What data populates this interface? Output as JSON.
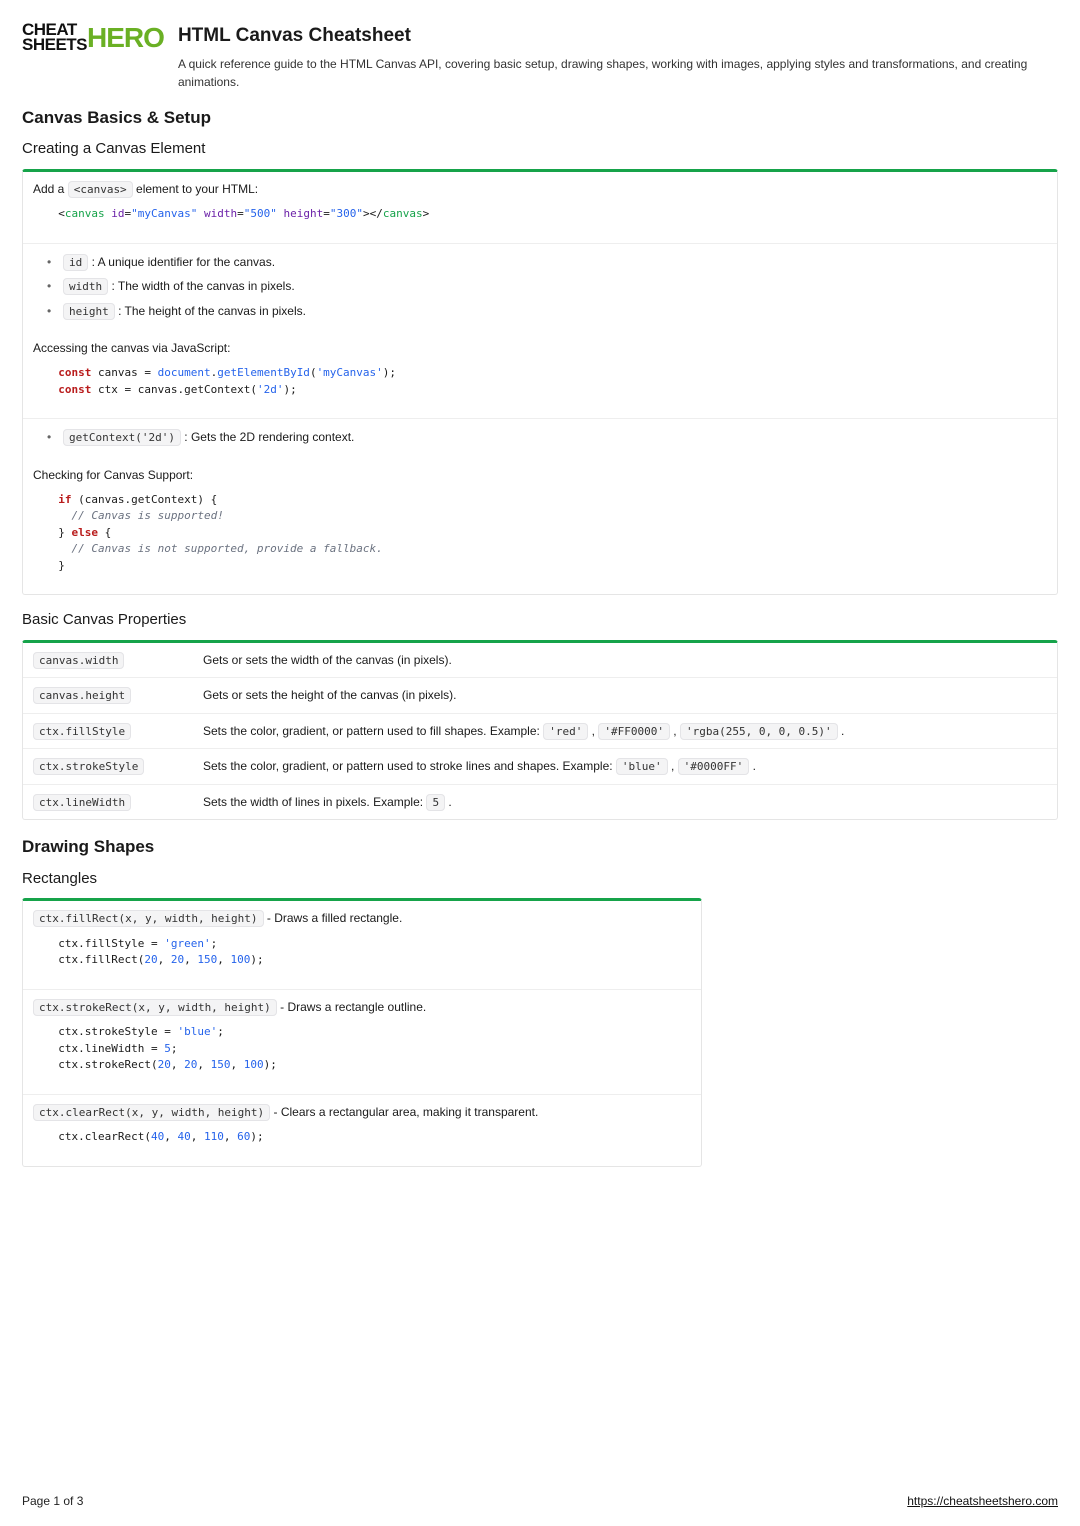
{
  "logo": {
    "left_top": "CHEAT",
    "left_bottom": "SHEETS",
    "right": "HERO"
  },
  "header": {
    "title": "HTML Canvas Cheatsheet",
    "subtitle": "A quick reference guide to the HTML Canvas API, covering basic setup, drawing shapes, working with images, applying styles and transformations, and creating animations."
  },
  "sections": {
    "basics_title": "Canvas Basics & Setup",
    "creating_title": "Creating a Canvas Element",
    "creating_intro_pre": "Add a ",
    "creating_intro_code": "<canvas>",
    "creating_intro_post": " element to your HTML:",
    "creating_snippet": {
      "tag_open": "canvas",
      "attr_id": "id",
      "val_id": "\"myCanvas\"",
      "attr_w": "width",
      "val_w": "\"500\"",
      "attr_h": "height",
      "val_h": "\"300\"",
      "tag_close": "canvas"
    },
    "creating_bullets": [
      {
        "code": "id",
        "text": " : A unique identifier for the canvas."
      },
      {
        "code": "width",
        "text": " : The width of the canvas in pixels."
      },
      {
        "code": "height",
        "text": " : The height of the canvas in pixels."
      }
    ],
    "accessing_title": "Accessing the canvas via JavaScript:",
    "accessing_snippet": {
      "kw1": "const",
      "l1a": " canvas = ",
      "fn1": "document",
      "l1b": ".",
      "fn2": "getElementById",
      "l1c": "(",
      "str1": "'myCanvas'",
      "l1d": ");",
      "kw2": "const",
      "l2a": " ctx = canvas.getContext(",
      "str2": "'2d'",
      "l2b": ");"
    },
    "accessing_bullet_code": "getContext('2d')",
    "accessing_bullet_text": " : Gets the 2D rendering context.",
    "checking_title": "Checking for Canvas Support:",
    "checking_snippet": {
      "kw_if": "if",
      "l1": " (canvas.getContext) {",
      "com1": "  // Canvas is supported!",
      "l2a": "} ",
      "kw_else": "else",
      "l2b": " {",
      "com2": "  // Canvas is not supported, provide a fallback.",
      "l3": "}"
    },
    "props_title": "Basic Canvas Properties",
    "props_rows": [
      {
        "code": "canvas.width",
        "desc": "Gets or sets the width of the canvas (in pixels)."
      },
      {
        "code": "canvas.height",
        "desc": "Gets or sets the height of the canvas (in pixels)."
      },
      {
        "code": "ctx.fillStyle",
        "desc_pre": "Sets the color, gradient, or pattern used to fill shapes. Example: ",
        "ex": [
          "'red'",
          "'#FF0000'",
          "'rgba(255, 0, 0, 0.5)'"
        ],
        "desc_post": " ."
      },
      {
        "code": "ctx.strokeStyle",
        "desc_pre": "Sets the color, gradient, or pattern used to stroke lines and shapes. Example: ",
        "ex": [
          "'blue'",
          "'#0000FF'"
        ],
        "desc_post": " ."
      },
      {
        "code": "ctx.lineWidth",
        "desc_pre": "Sets the width of lines in pixels. Example: ",
        "ex": [
          "5"
        ],
        "desc_post": " ."
      }
    ],
    "drawing_title": "Drawing Shapes",
    "rect_title": "Rectangles",
    "rect_rows": [
      {
        "sig": "ctx.fillRect(x, y, width, height)",
        "desc": " - Draws a filled rectangle.",
        "snippet": {
          "l1a": "ctx.fillStyle = ",
          "l1s": "'green'",
          "l1b": ";",
          "l2a": "ctx.fillRect(",
          "n1": "20",
          "s": ", ",
          "n2": "20",
          "n3": "150",
          "n4": "100",
          "l2b": ");"
        }
      },
      {
        "sig": "ctx.strokeRect(x, y, width, height)",
        "desc": " - Draws a rectangle outline.",
        "snippet": {
          "l1a": "ctx.strokeStyle = ",
          "l1s": "'blue'",
          "l1b": ";",
          "l2a": "ctx.lineWidth = ",
          "l2n": "5",
          "l2b": ";",
          "l3a": "ctx.strokeRect(",
          "n1": "20",
          "s": ", ",
          "n2": "20",
          "n3": "150",
          "n4": "100",
          "l3b": ");"
        }
      },
      {
        "sig": "ctx.clearRect(x, y, width, height)",
        "desc": " - Clears a rectangular area, making it transparent.",
        "snippet": {
          "l1a": "ctx.clearRect(",
          "n1": "40",
          "s": ", ",
          "n2": "40",
          "n3": "110",
          "n4": "60",
          "l1b": ");"
        }
      }
    ]
  },
  "footer": {
    "page": "Page 1 of 3",
    "url": "https://cheatsheetshero.com"
  }
}
